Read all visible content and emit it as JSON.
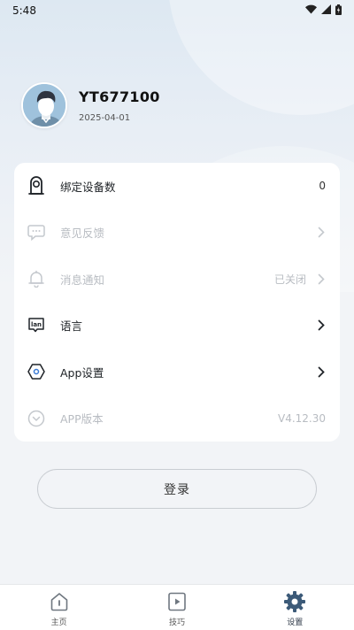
{
  "status_bar": {
    "time": "5:48"
  },
  "profile": {
    "username": "YT677100",
    "date": "2025-04-01"
  },
  "settings": {
    "bound_devices": {
      "label": "绑定设备数",
      "value": "0",
      "icon": "device-icon"
    },
    "feedback": {
      "label": "意见反馈",
      "icon": "chat-bubble-icon"
    },
    "notifications": {
      "label": "消息通知",
      "value": "已关闭",
      "icon": "bell-icon"
    },
    "language": {
      "label": "语言",
      "icon": "language-icon",
      "icon_text": "lan"
    },
    "app_settings": {
      "label": "App设置",
      "icon": "hexagon-settings-icon"
    },
    "app_version": {
      "label": "APP版本",
      "value": "V4.12.30",
      "icon": "chevron-circle-icon"
    }
  },
  "login": {
    "label": "登录"
  },
  "bottom_nav": {
    "home": {
      "label": "主页",
      "icon": "home-icon"
    },
    "tips": {
      "label": "技巧",
      "icon": "video-play-icon"
    },
    "settings": {
      "label": "设置",
      "icon": "gear-icon",
      "active": true
    }
  },
  "colors": {
    "background": "#f2f4f7",
    "card": "#ffffff",
    "disabled_text": "#b8bcc2",
    "active_nav": "#3c5a78"
  }
}
